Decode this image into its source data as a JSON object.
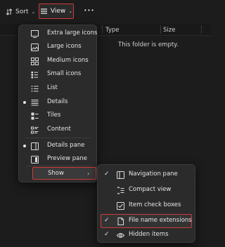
{
  "toolbar": {
    "sort_label": "Sort",
    "view_label": "View",
    "more_label": "•••"
  },
  "columns": {
    "type": "Type",
    "size": "Size"
  },
  "content": {
    "empty_message": "This folder is empty."
  },
  "view_menu": {
    "items": [
      {
        "label": "Extra large icons",
        "icon": "monitor-icon",
        "selected": false
      },
      {
        "label": "Large icons",
        "icon": "image-icon",
        "selected": false
      },
      {
        "label": "Medium icons",
        "icon": "medium-grid-icon",
        "selected": false
      },
      {
        "label": "Small icons",
        "icon": "small-grid-icon",
        "selected": false
      },
      {
        "label": "List",
        "icon": "list-icon",
        "selected": false
      },
      {
        "label": "Details",
        "icon": "details-icon",
        "selected": true
      },
      {
        "label": "Tiles",
        "icon": "tiles-icon",
        "selected": false
      },
      {
        "label": "Content",
        "icon": "content-icon",
        "selected": false
      }
    ],
    "panes": [
      {
        "label": "Details pane",
        "icon": "details-pane-icon",
        "selected": true
      },
      {
        "label": "Preview pane",
        "icon": "preview-pane-icon",
        "selected": false
      }
    ],
    "show_label": "Show"
  },
  "show_submenu": {
    "items": [
      {
        "label": "Navigation pane",
        "icon": "navigation-pane-icon",
        "checked": true
      },
      {
        "label": "Compact view",
        "icon": "compact-view-icon",
        "checked": false
      },
      {
        "label": "Item check boxes",
        "icon": "checkbox-icon",
        "checked": false
      },
      {
        "label": "File name extensions",
        "icon": "file-icon",
        "checked": true
      },
      {
        "label": "Hidden items",
        "icon": "eye-icon",
        "checked": true
      }
    ]
  },
  "colors": {
    "highlight_border": "#d03b3b",
    "menu_bg": "#2b2b2b",
    "window_bg": "#1c1c1c"
  }
}
